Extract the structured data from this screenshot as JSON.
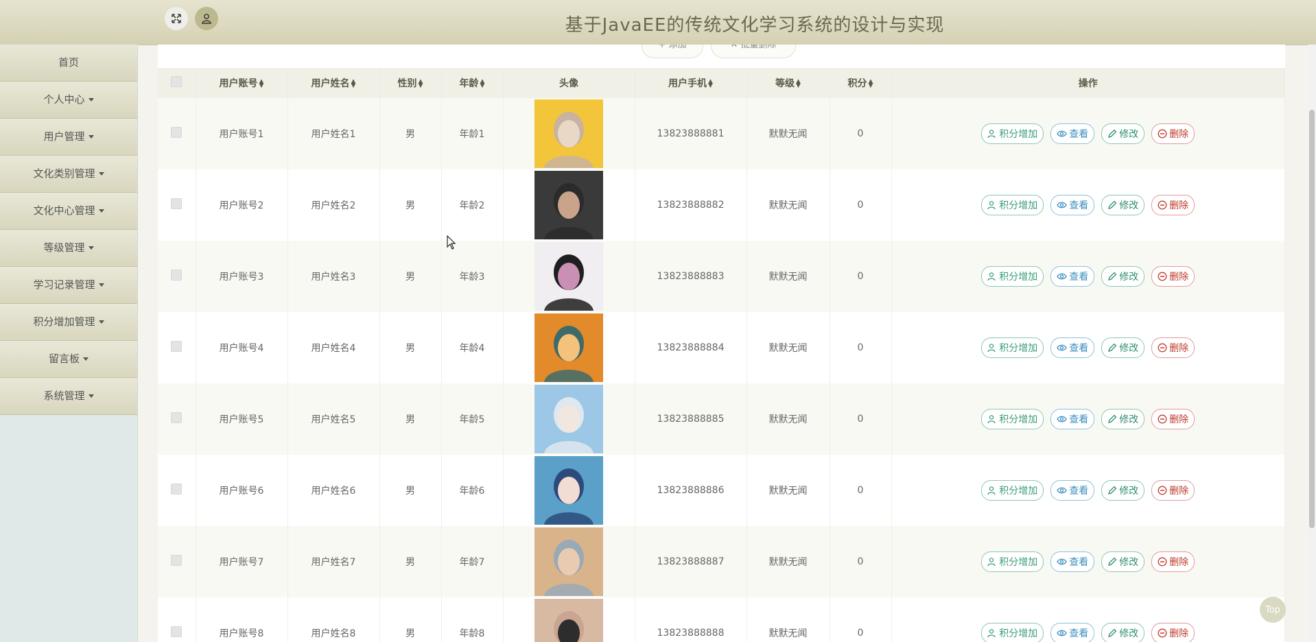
{
  "header": {
    "title": "基于JavaEE的传统文化学习系统的设计与实现"
  },
  "sidebar": {
    "items": [
      {
        "label": "首页",
        "dropdown": false
      },
      {
        "label": "个人中心",
        "dropdown": true
      },
      {
        "label": "用户管理",
        "dropdown": true
      },
      {
        "label": "文化类别管理",
        "dropdown": true
      },
      {
        "label": "文化中心管理",
        "dropdown": true
      },
      {
        "label": "等级管理",
        "dropdown": true
      },
      {
        "label": "学习记录管理",
        "dropdown": true
      },
      {
        "label": "积分增加管理",
        "dropdown": true
      },
      {
        "label": "留言板",
        "dropdown": true
      },
      {
        "label": "系统管理",
        "dropdown": true
      }
    ]
  },
  "table": {
    "columns": [
      {
        "label": "",
        "sortable": false
      },
      {
        "label": "用户账号",
        "sortable": true
      },
      {
        "label": "用户姓名",
        "sortable": true
      },
      {
        "label": "性别",
        "sortable": true
      },
      {
        "label": "年龄",
        "sortable": true
      },
      {
        "label": "头像",
        "sortable": false
      },
      {
        "label": "用户手机",
        "sortable": true
      },
      {
        "label": "等级",
        "sortable": true
      },
      {
        "label": "积分",
        "sortable": true
      },
      {
        "label": "操作",
        "sortable": false
      }
    ],
    "rows": [
      {
        "account": "用户账号1",
        "name": "用户姓名1",
        "gender": "男",
        "age": "年龄1",
        "phone": "13823888881",
        "level": "默默无闻",
        "points": "0",
        "avatar_colors": [
          "#f2c53a",
          "#e9d8c6",
          "#c9b3a0"
        ]
      },
      {
        "account": "用户账号2",
        "name": "用户姓名2",
        "gender": "男",
        "age": "年龄2",
        "phone": "13823888882",
        "level": "默默无闻",
        "points": "0",
        "avatar_colors": [
          "#3a3a3a",
          "#c9a48a",
          "#2b2b2b"
        ]
      },
      {
        "account": "用户账号3",
        "name": "用户姓名3",
        "gender": "男",
        "age": "年龄3",
        "phone": "13823888883",
        "level": "默默无闻",
        "points": "0",
        "avatar_colors": [
          "#f0eef0",
          "#c98fb5",
          "#1f1f1f"
        ]
      },
      {
        "account": "用户账号4",
        "name": "用户姓名4",
        "gender": "男",
        "age": "年龄4",
        "phone": "13823888884",
        "level": "默默无闻",
        "points": "0",
        "avatar_colors": [
          "#e38a2a",
          "#f4c27a",
          "#3e6b6a"
        ]
      },
      {
        "account": "用户账号5",
        "name": "用户姓名5",
        "gender": "男",
        "age": "年龄5",
        "phone": "13823888885",
        "level": "默默无闻",
        "points": "0",
        "avatar_colors": [
          "#9cc7e6",
          "#f1e7e0",
          "#dfe7ef"
        ]
      },
      {
        "account": "用户账号6",
        "name": "用户姓名6",
        "gender": "男",
        "age": "年龄6",
        "phone": "13823888886",
        "level": "默默无闻",
        "points": "0",
        "avatar_colors": [
          "#5aa0c8",
          "#f2dcd3",
          "#2c4b7a"
        ]
      },
      {
        "account": "用户账号7",
        "name": "用户姓名7",
        "gender": "男",
        "age": "年龄7",
        "phone": "13823888887",
        "level": "默默无闻",
        "points": "0",
        "avatar_colors": [
          "#d9b48a",
          "#e9cbb2",
          "#9aa9b7"
        ]
      },
      {
        "account": "用户账号8",
        "name": "用户姓名8",
        "gender": "男",
        "age": "年龄8",
        "phone": "13823888888",
        "level": "默默无闻",
        "points": "0",
        "avatar_colors": [
          "#d8b9a2",
          "#2d2d2d",
          "#c9a592"
        ]
      }
    ],
    "actions": {
      "points": "积分增加",
      "view": "查看",
      "edit": "修改",
      "delete": "删除"
    }
  },
  "toolbar": {
    "add": "+ 添加",
    "batch_delete": "✕ 批量删除"
  },
  "back_to_top": "Top",
  "colors": {
    "header_bg": "#d9d6ba",
    "sidebar_item_bg": "#e2e0ca",
    "row_alt": "#f9f9f3"
  }
}
